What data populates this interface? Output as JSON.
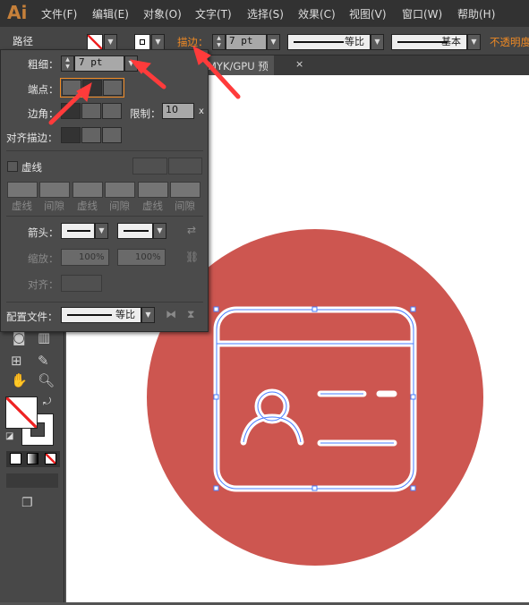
{
  "app": {
    "logo": "Ai"
  },
  "menu": [
    "文件(F)",
    "编辑(E)",
    "对象(O)",
    "文字(T)",
    "选择(S)",
    "效果(C)",
    "视图(V)",
    "窗口(W)",
    "帮助(H)"
  ],
  "control_bar": {
    "object_type": "路径",
    "stroke_label": "描边：",
    "stroke_weight": "7 pt",
    "profile": "等比",
    "brush": "基本",
    "opacity_label": "不透明度"
  },
  "document_tab": {
    "title": "MYK/GPU 预览)",
    "close": "×"
  },
  "stroke_panel": {
    "weight_label": "粗细：",
    "weight_value": "7 pt",
    "cap_label": "端点：",
    "corner_label": "边角：",
    "limit_label": "限制：",
    "limit_value": "10",
    "limit_unit": "x",
    "align_label": "对齐描边：",
    "dashed_label": "虚线",
    "dash_fields": [
      "虚线",
      "间隙",
      "虚线",
      "间隙",
      "虚线",
      "间隙"
    ],
    "arrow_label": "箭头：",
    "scale_label": "缩放：",
    "scale_start": "100%",
    "scale_end": "100%",
    "arrow_align_label": "对齐：",
    "profile_label": "配置文件：",
    "profile_value": "等比",
    "selected_cap": "round"
  },
  "colors": {
    "accent": "#f08a24",
    "circle": "#cd5650",
    "selection": "#4a7cff",
    "arrow": "#ff3b3b"
  }
}
